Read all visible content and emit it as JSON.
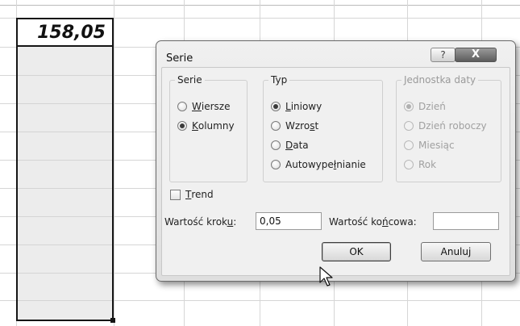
{
  "sheet": {
    "active_cell_value": "158,05"
  },
  "dialog": {
    "title": "Serie",
    "help_label": "?",
    "close_label": "X",
    "series_in": {
      "title": "Serie",
      "options": [
        {
          "pre": "",
          "key": "W",
          "post": "iersze",
          "selected": false
        },
        {
          "pre": "",
          "key": "K",
          "post": "olumny",
          "selected": true
        }
      ]
    },
    "type": {
      "title": "Typ",
      "options": [
        {
          "pre": "",
          "key": "L",
          "post": "iniowy",
          "selected": true
        },
        {
          "pre": "Wzro",
          "key": "s",
          "post": "t",
          "selected": false
        },
        {
          "pre": "",
          "key": "D",
          "post": "ata",
          "selected": false
        },
        {
          "pre": "Autowype",
          "key": "ł",
          "post": "nianie",
          "selected": false
        }
      ]
    },
    "date_unit": {
      "title": "Jednostka daty",
      "options": [
        {
          "label": "Dzień",
          "selected": true
        },
        {
          "label": "Dzień roboczy",
          "selected": false
        },
        {
          "label": "Miesiąc",
          "selected": false
        },
        {
          "label": "Rok",
          "selected": false
        }
      ]
    },
    "trend": {
      "pre": "",
      "key": "T",
      "post": "rend",
      "checked": false
    },
    "step": {
      "pre": "Wartość krok",
      "key": "u",
      "post": ":",
      "value": "0,05"
    },
    "stop": {
      "pre": "Wartość ko",
      "key": "ń",
      "post": "cowa:",
      "value": ""
    },
    "ok_label": "OK",
    "cancel_label": "Anuluj"
  }
}
